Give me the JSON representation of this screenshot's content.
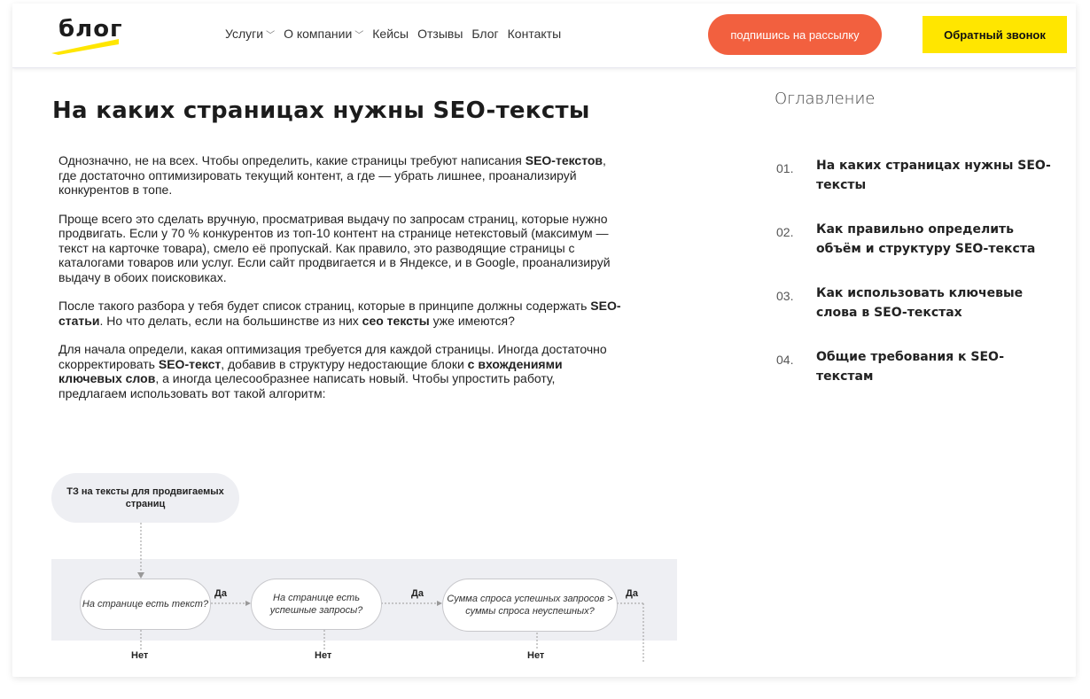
{
  "header": {
    "logo_text": "блог",
    "nav": [
      {
        "label": "Услуги",
        "dropdown": true
      },
      {
        "label": "О компании",
        "dropdown": true
      },
      {
        "label": "Кейсы",
        "dropdown": false
      },
      {
        "label": "Отзывы",
        "dropdown": false
      },
      {
        "label": "Блог",
        "dropdown": false
      },
      {
        "label": "Контакты",
        "dropdown": false
      }
    ],
    "subscribe_button": "подпишись на рассылку",
    "callback_button": "Обратный звонок",
    "colors": {
      "accent_orange": "#f2603f",
      "accent_yellow": "#ffe600"
    }
  },
  "article": {
    "title": "На каких страницах нужны SEO-тексты",
    "paragraphs": [
      "Однозначно, не на всех. Чтобы определить, какие страницы требуют написания <b>SEO-текстов</b>, где достаточно оптимизировать текущий контент, а где — убрать лишнее, проанализируй конкурентов в топе.",
      "Проще всего это сделать вручную, просматривая выдачу по запросам страниц, которые нужно продвигать. Если у 70 % конкурентов из топ-10 контент на странице нетекстовый (максимум — текст на карточке товара), смело её пропускай. Как правило, это разводящие страницы с каталогами товаров или услуг. Если сайт продвигается и в Яндексе, и в Google, проанализируй выдачу в обоих поисковиках.",
      "После такого разбора у тебя будет список страниц, которые в принципе должны содержать <b>SEO-статьи</b>. Но что делать, если на большинстве из них <b>сео тексты</b> уже имеются?",
      "Для начала определи, какая оптимизация требуется для каждой страницы. Иногда достаточно скорректировать <b>SEO-текст</b>, добавив в структуру недостающие блоки <b>с вхождениями ключевых слов</b>, а иногда целесообразнее написать новый. Чтобы упростить работу, предлагаем использовать вот такой алгоритм:"
    ]
  },
  "toc": {
    "title": "Оглавление",
    "items": [
      {
        "num": "01.",
        "label": "На каких страницах нужны SEO-тексты"
      },
      {
        "num": "02.",
        "label": "Как правильно определить объём и структуру SEO-текста"
      },
      {
        "num": "03.",
        "label": "Как использовать ключевые слова в SEO-текстах"
      },
      {
        "num": "04.",
        "label": "Общие требования к SEO-текстам"
      }
    ]
  },
  "flowchart": {
    "start": "ТЗ на тексты для продвигаемых страниц",
    "decisions": [
      "На странице есть текст?",
      "На странице есть успешные запросы?",
      "Сумма спроса успешных запросов > суммы спроса неуспешных?"
    ],
    "yes_label": "Да",
    "no_label": "Нет"
  }
}
